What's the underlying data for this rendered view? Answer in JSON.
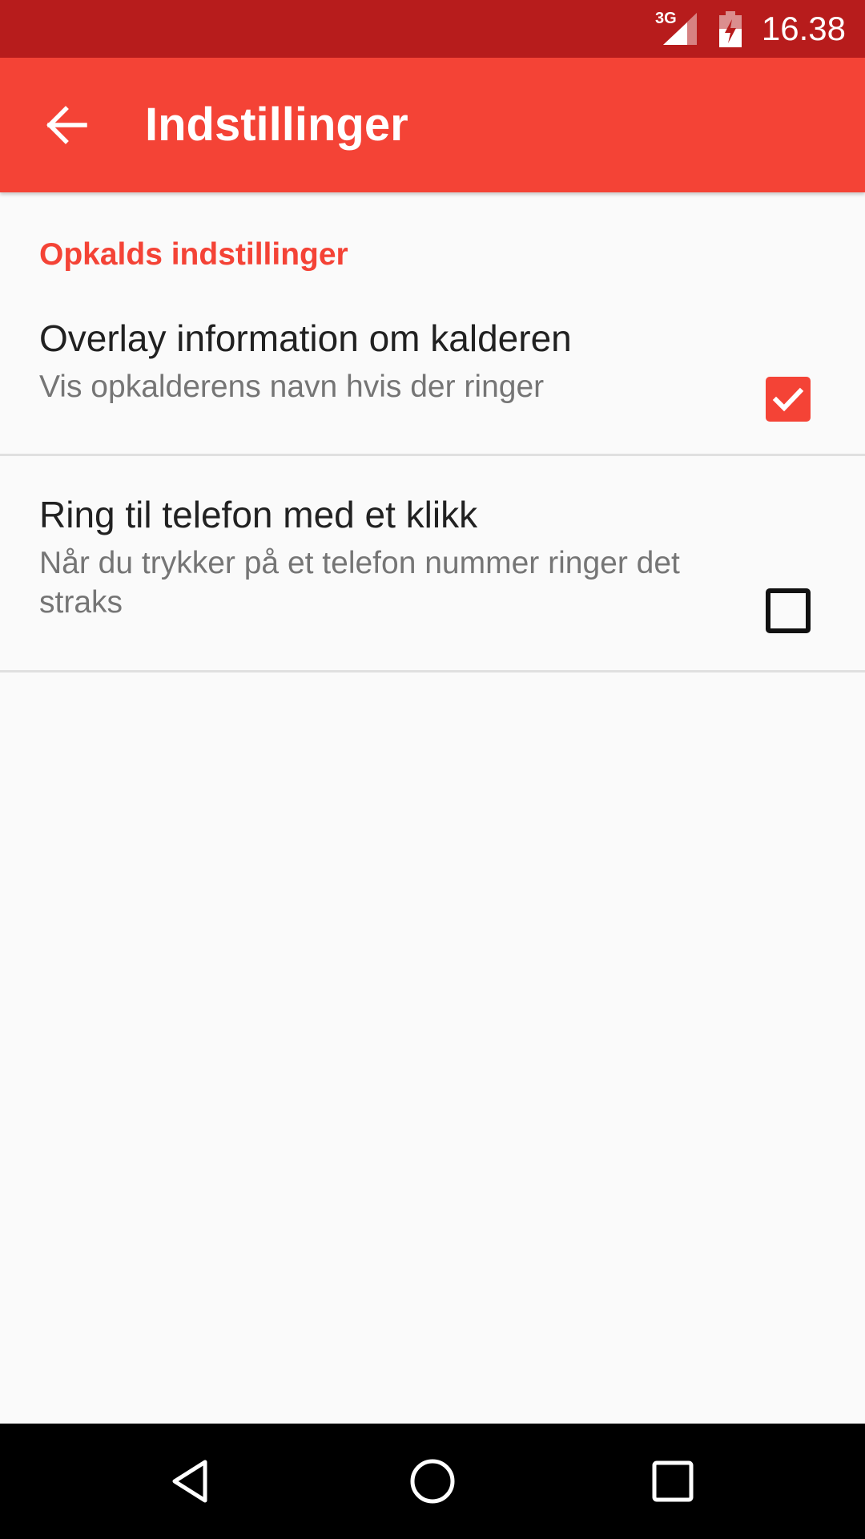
{
  "status_bar": {
    "network": "3G",
    "time": "16.38"
  },
  "app_bar": {
    "title": "Indstillinger",
    "back_icon": "arrow-back-icon"
  },
  "settings": {
    "category": "Opkalds indstillinger",
    "items": [
      {
        "title": "Overlay information om kalderen",
        "summary": "Vis opkalderens navn hvis der ringer",
        "checked": true
      },
      {
        "title": "Ring til telefon med et klikk",
        "summary": "Når du trykker på et telefon nummer ringer det straks",
        "checked": false
      }
    ]
  },
  "nav_bar": {
    "icons": [
      "nav-back-icon",
      "nav-home-icon",
      "nav-recents-icon"
    ]
  },
  "colors": {
    "status_bar": "#b71c1c",
    "primary": "#f44336",
    "accent": "#f44336",
    "background": "#fafafa",
    "title_text": "#212121",
    "summary_text": "#757575"
  }
}
